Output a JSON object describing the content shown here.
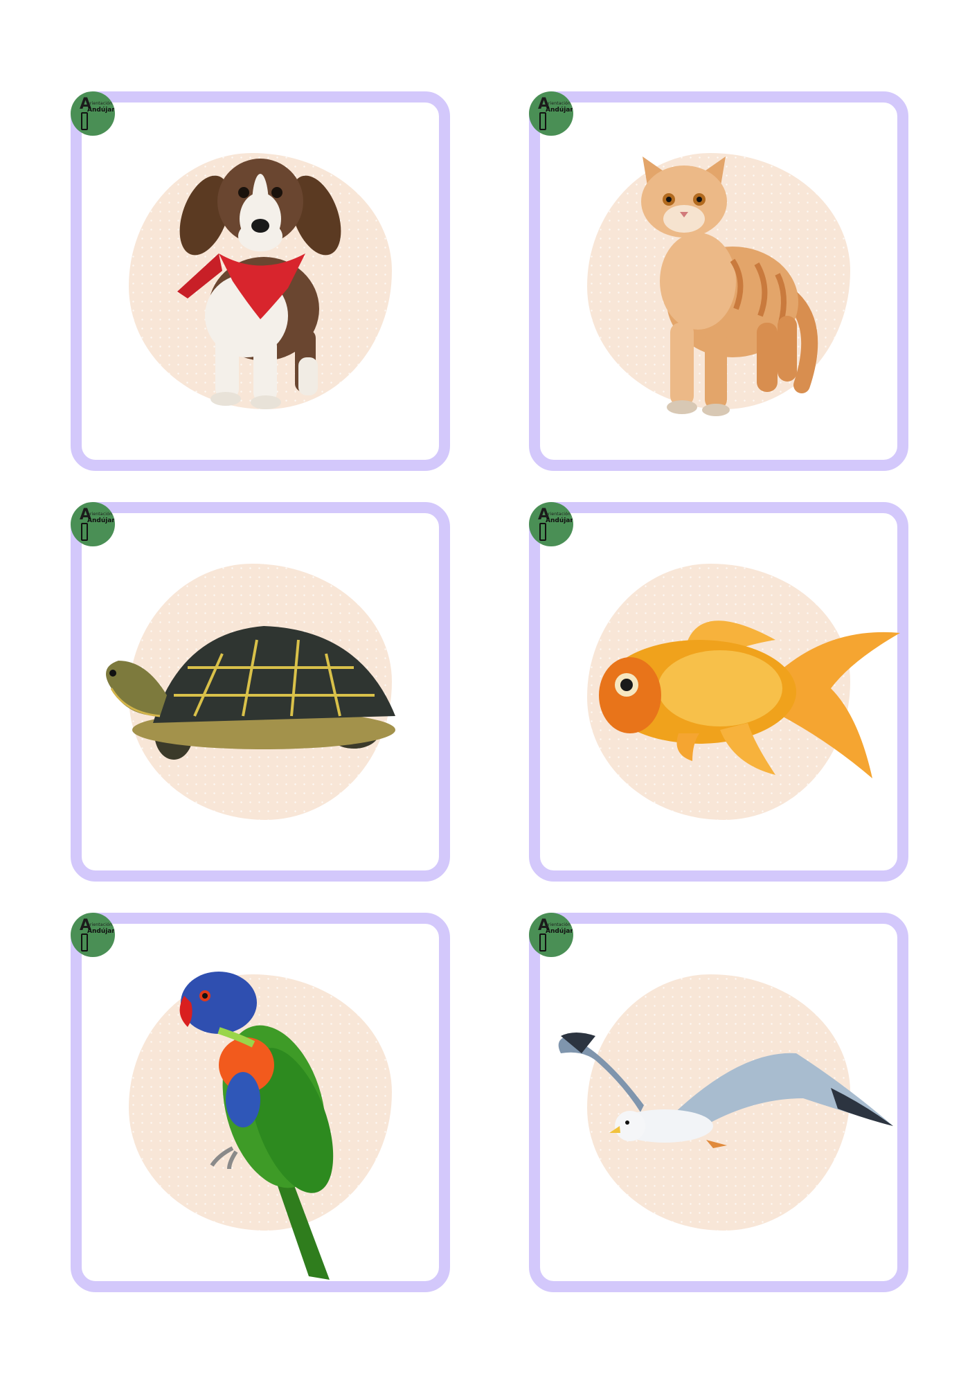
{
  "logo": {
    "initial": "A",
    "tagline": "orientación",
    "name": "Andújar",
    "color": "#4a8f55"
  },
  "card_border_color": "#d3c8fb",
  "blob_color": "#f8e6d7",
  "cards": [
    {
      "animal": "dog-icon"
    },
    {
      "animal": "cat-icon"
    },
    {
      "animal": "turtle-icon"
    },
    {
      "animal": "goldfish-icon"
    },
    {
      "animal": "parrot-icon"
    },
    {
      "animal": "seagull-icon"
    }
  ]
}
